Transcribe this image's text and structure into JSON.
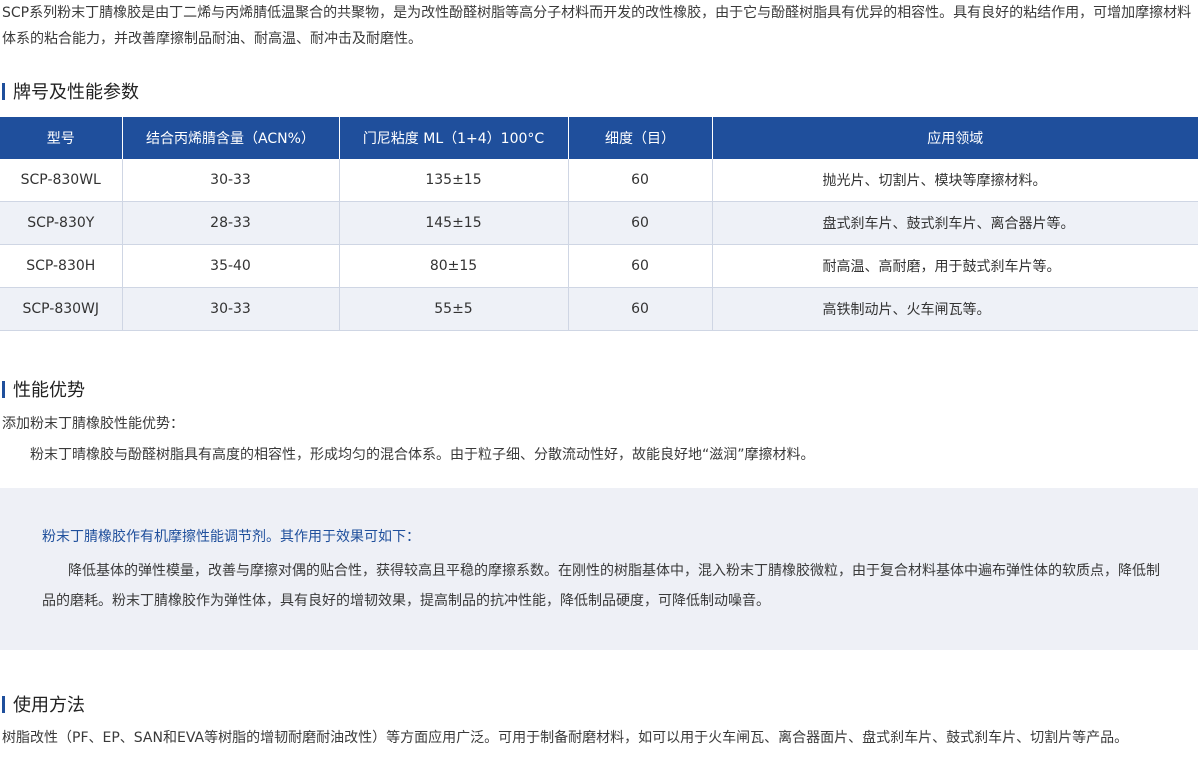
{
  "intro": "SCP系列粉末丁腈橡胶是由丁二烯与丙烯腈低温聚合的共聚物，是为改性酚醛树脂等高分子材料而开发的改性橡胶，由于它与酚醛树脂具有优异的相容性。具有良好的粘结作用，可增加摩擦材料体系的粘合能力，并改善摩擦制品耐油、耐高温、耐冲击及耐磨性。",
  "sections": {
    "specs_title": "牌号及性能参数",
    "advantages_title": "性能优势",
    "usage_title": "使用方法"
  },
  "table": {
    "headers": [
      "型号",
      "结合丙烯腈含量（ACN%）",
      "门尼粘度 ML（1+4）100°C",
      "细度（目）",
      "应用领域"
    ],
    "rows": [
      [
        "SCP-830WL",
        "30-33",
        "135±15",
        "60",
        "抛光片、切割片、模块等摩擦材料。"
      ],
      [
        "SCP-830Y",
        "28-33",
        "145±15",
        "60",
        "盘式刹车片、鼓式刹车片、离合器片等。"
      ],
      [
        "SCP-830H",
        "35-40",
        "80±15",
        "60",
        "耐高温、高耐磨，用于鼓式刹车片等。"
      ],
      [
        "SCP-830WJ",
        "30-33",
        "55±5",
        "60",
        "高铁制动片、火车闸瓦等。"
      ]
    ]
  },
  "advantages": {
    "lead": "添加粉末丁腈橡胶性能优势：",
    "point": "粉末丁晴橡胶与酚醛树脂具有高度的相容性，形成均匀的混合体系。由于粒子细、分散流动性好，故能良好地“滋润”摩擦材料。"
  },
  "callout": {
    "title": "粉末丁腈橡胶作有机摩擦性能调节剂。其作用于效果可如下：",
    "body": "降低基体的弹性模量，改善与摩擦对偶的贴合性，获得较高且平稳的摩擦系数。在刚性的树脂基体中，混入粉末丁腈橡胶微粒，由于复合材料基体中遍布弹性体的软质点，降低制品的磨耗。粉末丁腈橡胶作为弹性体，具有良好的增韧效果，提高制品的抗冲性能，降低制品硬度，可降低制动噪音。"
  },
  "usage": "树脂改性（PF、EP、SAN和EVA等树脂的增韧耐磨耐油改性）等方面应用广泛。可用于制备耐磨材料，如可以用于火车闸瓦、离合器面片、盘式刹车片、鼓式刹车片、切割片等产品。",
  "colors": {
    "accent": "#1f4f9c",
    "row_alt": "#eef1f7",
    "callout_bg": "#eef0f6"
  }
}
